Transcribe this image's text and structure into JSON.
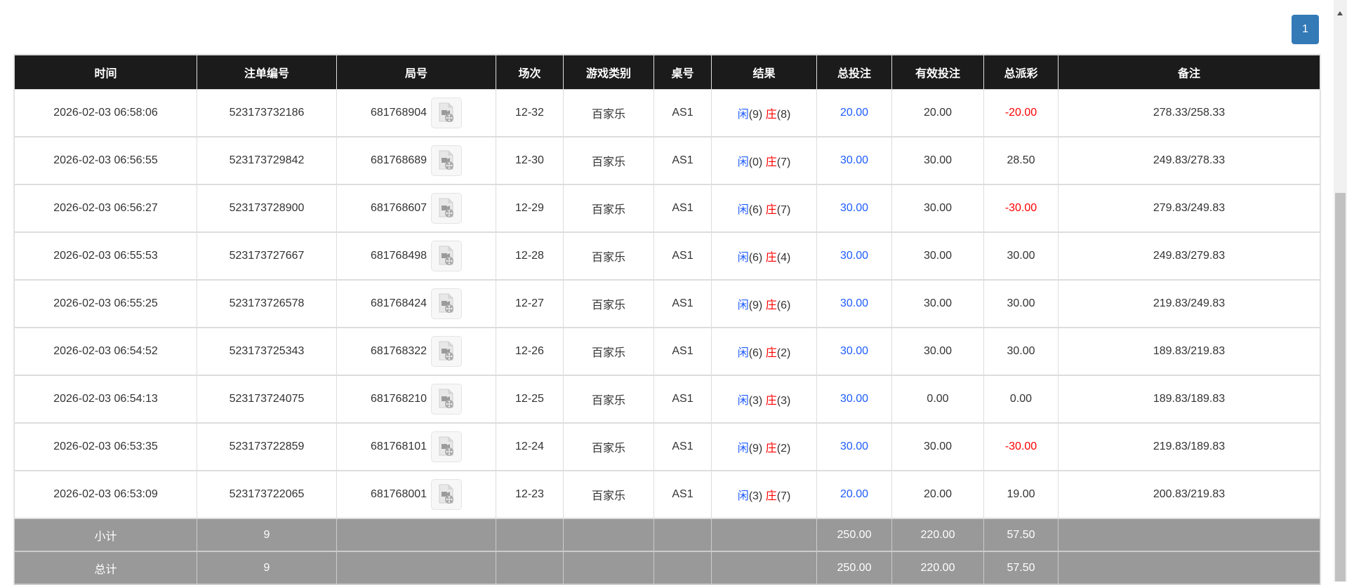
{
  "pagination": {
    "current": "1"
  },
  "table": {
    "headers": [
      "时间",
      "注单编号",
      "局号",
      "场次",
      "游戏类别",
      "桌号",
      "结果",
      "总投注",
      "有效投注",
      "总派彩",
      "备注"
    ],
    "rows": [
      {
        "time": "2026-02-03 06:58:06",
        "bet_id": "523173732186",
        "round": "681768904",
        "session": "12-32",
        "game": "百家乐",
        "table": "AS1",
        "player": "闲",
        "player_pts": "(9)",
        "banker": "庄",
        "banker_pts": "(8)",
        "total_bet": "20.00",
        "valid_bet": "20.00",
        "payout": "-20.00",
        "payout_neg": true,
        "note": "278.33/258.33"
      },
      {
        "time": "2026-02-03 06:56:55",
        "bet_id": "523173729842",
        "round": "681768689",
        "session": "12-30",
        "game": "百家乐",
        "table": "AS1",
        "player": "闲",
        "player_pts": "(0)",
        "banker": "庄",
        "banker_pts": "(7)",
        "total_bet": "30.00",
        "valid_bet": "30.00",
        "payout": "28.50",
        "payout_neg": false,
        "note": "249.83/278.33"
      },
      {
        "time": "2026-02-03 06:56:27",
        "bet_id": "523173728900",
        "round": "681768607",
        "session": "12-29",
        "game": "百家乐",
        "table": "AS1",
        "player": "闲",
        "player_pts": "(6)",
        "banker": "庄",
        "banker_pts": "(7)",
        "total_bet": "30.00",
        "valid_bet": "30.00",
        "payout": "-30.00",
        "payout_neg": true,
        "note": "279.83/249.83"
      },
      {
        "time": "2026-02-03 06:55:53",
        "bet_id": "523173727667",
        "round": "681768498",
        "session": "12-28",
        "game": "百家乐",
        "table": "AS1",
        "player": "闲",
        "player_pts": "(6)",
        "banker": "庄",
        "banker_pts": "(4)",
        "total_bet": "30.00",
        "valid_bet": "30.00",
        "payout": "30.00",
        "payout_neg": false,
        "note": "249.83/279.83"
      },
      {
        "time": "2026-02-03 06:55:25",
        "bet_id": "523173726578",
        "round": "681768424",
        "session": "12-27",
        "game": "百家乐",
        "table": "AS1",
        "player": "闲",
        "player_pts": "(9)",
        "banker": "庄",
        "banker_pts": "(6)",
        "total_bet": "30.00",
        "valid_bet": "30.00",
        "payout": "30.00",
        "payout_neg": false,
        "note": "219.83/249.83"
      },
      {
        "time": "2026-02-03 06:54:52",
        "bet_id": "523173725343",
        "round": "681768322",
        "session": "12-26",
        "game": "百家乐",
        "table": "AS1",
        "player": "闲",
        "player_pts": "(6)",
        "banker": "庄",
        "banker_pts": "(2)",
        "total_bet": "30.00",
        "valid_bet": "30.00",
        "payout": "30.00",
        "payout_neg": false,
        "note": "189.83/219.83"
      },
      {
        "time": "2026-02-03 06:54:13",
        "bet_id": "523173724075",
        "round": "681768210",
        "session": "12-25",
        "game": "百家乐",
        "table": "AS1",
        "player": "闲",
        "player_pts": "(3)",
        "banker": "庄",
        "banker_pts": "(3)",
        "total_bet": "30.00",
        "valid_bet": "0.00",
        "payout": "0.00",
        "payout_neg": false,
        "note": "189.83/189.83"
      },
      {
        "time": "2026-02-03 06:53:35",
        "bet_id": "523173722859",
        "round": "681768101",
        "session": "12-24",
        "game": "百家乐",
        "table": "AS1",
        "player": "闲",
        "player_pts": "(9)",
        "banker": "庄",
        "banker_pts": "(2)",
        "total_bet": "30.00",
        "valid_bet": "30.00",
        "payout": "-30.00",
        "payout_neg": true,
        "note": "219.83/189.83"
      },
      {
        "time": "2026-02-03 06:53:09",
        "bet_id": "523173722065",
        "round": "681768001",
        "session": "12-23",
        "game": "百家乐",
        "table": "AS1",
        "player": "闲",
        "player_pts": "(3)",
        "banker": "庄",
        "banker_pts": "(7)",
        "total_bet": "20.00",
        "valid_bet": "20.00",
        "payout": "19.00",
        "payout_neg": false,
        "note": "200.83/219.83"
      }
    ],
    "footer": [
      {
        "label": "小计",
        "count": "9",
        "total_bet": "250.00",
        "valid_bet": "220.00",
        "payout": "57.50"
      },
      {
        "label": "总计",
        "count": "9",
        "total_bet": "250.00",
        "valid_bet": "220.00",
        "payout": "57.50"
      }
    ]
  },
  "icons": {
    "replay": "video-file-icon"
  },
  "colors": {
    "header_bg": "#1b1b1b",
    "footer_bg": "#999999",
    "player": "#1e5cff",
    "banker": "#ff0000",
    "negative": "#ff0000",
    "page_button": "#337ab7"
  }
}
